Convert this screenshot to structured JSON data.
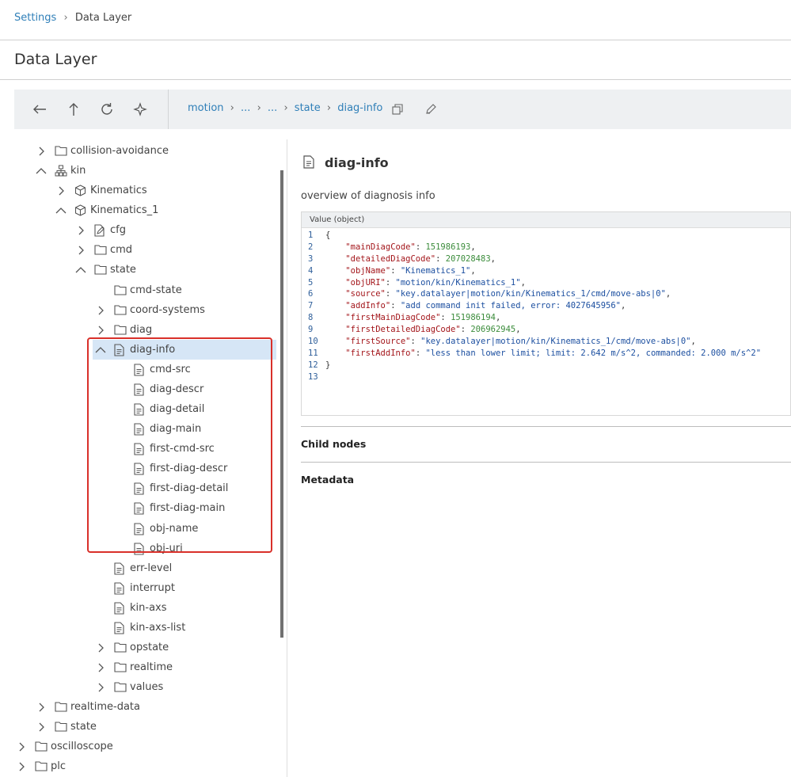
{
  "breadcrumb": {
    "root": "Settings",
    "sep": "›",
    "current": "Data Layer"
  },
  "page_title": "Data Layer",
  "toolbar": {
    "icons": [
      "back-arrow-icon",
      "up-arrow-icon",
      "refresh-icon",
      "locate-icon",
      "copy-icon",
      "edit-icon"
    ],
    "path": [
      "motion",
      "...",
      "...",
      "state",
      "diag-info"
    ],
    "path_sep": "›"
  },
  "tree": {
    "items": [
      {
        "label": "collision-avoidance",
        "icon": "folder-icon",
        "chevron": "right"
      },
      {
        "label": "kin",
        "icon": "network-icon",
        "chevron": "down"
      },
      {
        "label": "Kinematics",
        "icon": "cube-icon",
        "chevron": "right"
      },
      {
        "label": "Kinematics_1",
        "icon": "cube-icon",
        "chevron": "down"
      },
      {
        "label": "cfg",
        "icon": "edit-document-icon",
        "chevron": "right"
      },
      {
        "label": "cmd",
        "icon": "folder-icon",
        "chevron": "right"
      },
      {
        "label": "state",
        "icon": "folder-icon",
        "chevron": "down"
      },
      {
        "label": "cmd-state",
        "icon": "folder-icon",
        "chevron": "none"
      },
      {
        "label": "coord-systems",
        "icon": "folder-icon",
        "chevron": "right"
      },
      {
        "label": "diag",
        "icon": "folder-icon",
        "chevron": "right"
      },
      {
        "label": "diag-info",
        "icon": "document-icon",
        "chevron": "down",
        "selected": true
      },
      {
        "label": "cmd-src",
        "icon": "document-icon",
        "chevron": "none"
      },
      {
        "label": "diag-descr",
        "icon": "document-icon",
        "chevron": "none"
      },
      {
        "label": "diag-detail",
        "icon": "document-icon",
        "chevron": "none"
      },
      {
        "label": "diag-main",
        "icon": "document-icon",
        "chevron": "none"
      },
      {
        "label": "first-cmd-src",
        "icon": "document-icon",
        "chevron": "none"
      },
      {
        "label": "first-diag-descr",
        "icon": "document-icon",
        "chevron": "none"
      },
      {
        "label": "first-diag-detail",
        "icon": "document-icon",
        "chevron": "none"
      },
      {
        "label": "first-diag-main",
        "icon": "document-icon",
        "chevron": "none"
      },
      {
        "label": "obj-name",
        "icon": "document-icon",
        "chevron": "none"
      },
      {
        "label": "obj-uri",
        "icon": "document-icon",
        "chevron": "none"
      },
      {
        "label": "err-level",
        "icon": "document-icon",
        "chevron": "none"
      },
      {
        "label": "interrupt",
        "icon": "document-icon",
        "chevron": "none"
      },
      {
        "label": "kin-axs",
        "icon": "document-icon",
        "chevron": "none"
      },
      {
        "label": "kin-axs-list",
        "icon": "document-icon",
        "chevron": "none"
      },
      {
        "label": "opstate",
        "icon": "folder-icon",
        "chevron": "right"
      },
      {
        "label": "realtime",
        "icon": "folder-icon",
        "chevron": "right"
      },
      {
        "label": "values",
        "icon": "folder-icon",
        "chevron": "right"
      },
      {
        "label": "realtime-data",
        "icon": "folder-icon",
        "chevron": "right"
      },
      {
        "label": "state",
        "icon": "folder-icon",
        "chevron": "right"
      },
      {
        "label": "oscilloscope",
        "icon": "folder-icon",
        "chevron": "right"
      },
      {
        "label": "plc",
        "icon": "folder-icon",
        "chevron": "right"
      }
    ]
  },
  "detail": {
    "title": "diag-info",
    "description": "overview of diagnosis info",
    "value_header": "Value (object)",
    "code_lines": [
      [
        {
          "t": "p",
          "v": "{"
        }
      ],
      [
        {
          "t": "p",
          "v": "    "
        },
        {
          "t": "k",
          "v": "\"mainDiagCode\""
        },
        {
          "t": "p",
          "v": ": "
        },
        {
          "t": "num",
          "v": "151986193"
        },
        {
          "t": "p",
          "v": ","
        }
      ],
      [
        {
          "t": "p",
          "v": "    "
        },
        {
          "t": "k",
          "v": "\"detailedDiagCode\""
        },
        {
          "t": "p",
          "v": ": "
        },
        {
          "t": "num",
          "v": "207028483"
        },
        {
          "t": "p",
          "v": ","
        }
      ],
      [
        {
          "t": "p",
          "v": "    "
        },
        {
          "t": "k",
          "v": "\"objName\""
        },
        {
          "t": "p",
          "v": ": "
        },
        {
          "t": "str",
          "v": "\"Kinematics_1\""
        },
        {
          "t": "p",
          "v": ","
        }
      ],
      [
        {
          "t": "p",
          "v": "    "
        },
        {
          "t": "k",
          "v": "\"objURI\""
        },
        {
          "t": "p",
          "v": ": "
        },
        {
          "t": "str",
          "v": "\"motion/kin/Kinematics_1\""
        },
        {
          "t": "p",
          "v": ","
        }
      ],
      [
        {
          "t": "p",
          "v": "    "
        },
        {
          "t": "k",
          "v": "\"source\""
        },
        {
          "t": "p",
          "v": ": "
        },
        {
          "t": "str",
          "v": "\"key.datalayer|motion/kin/Kinematics_1/cmd/move-abs|0\""
        },
        {
          "t": "p",
          "v": ","
        }
      ],
      [
        {
          "t": "p",
          "v": "    "
        },
        {
          "t": "k",
          "v": "\"addInfo\""
        },
        {
          "t": "p",
          "v": ": "
        },
        {
          "t": "str",
          "v": "\"add command init failed, error: 4027645956\""
        },
        {
          "t": "p",
          "v": ","
        }
      ],
      [
        {
          "t": "p",
          "v": "    "
        },
        {
          "t": "k",
          "v": "\"firstMainDiagCode\""
        },
        {
          "t": "p",
          "v": ": "
        },
        {
          "t": "num",
          "v": "151986194"
        },
        {
          "t": "p",
          "v": ","
        }
      ],
      [
        {
          "t": "p",
          "v": "    "
        },
        {
          "t": "k",
          "v": "\"firstDetailedDiagCode\""
        },
        {
          "t": "p",
          "v": ": "
        },
        {
          "t": "num",
          "v": "206962945"
        },
        {
          "t": "p",
          "v": ","
        }
      ],
      [
        {
          "t": "p",
          "v": "    "
        },
        {
          "t": "k",
          "v": "\"firstSource\""
        },
        {
          "t": "p",
          "v": ": "
        },
        {
          "t": "str",
          "v": "\"key.datalayer|motion/kin/Kinematics_1/cmd/move-abs|0\""
        },
        {
          "t": "p",
          "v": ","
        }
      ],
      [
        {
          "t": "p",
          "v": "    "
        },
        {
          "t": "k",
          "v": "\"firstAddInfo\""
        },
        {
          "t": "p",
          "v": ": "
        },
        {
          "t": "str",
          "v": "\"less than lower limit; limit: 2.642 m/s^2, commanded: 2.000 m/s^2\""
        }
      ],
      [
        {
          "t": "p",
          "v": "}"
        }
      ],
      []
    ],
    "child_nodes_label": "Child nodes",
    "metadata_label": "Metadata"
  }
}
